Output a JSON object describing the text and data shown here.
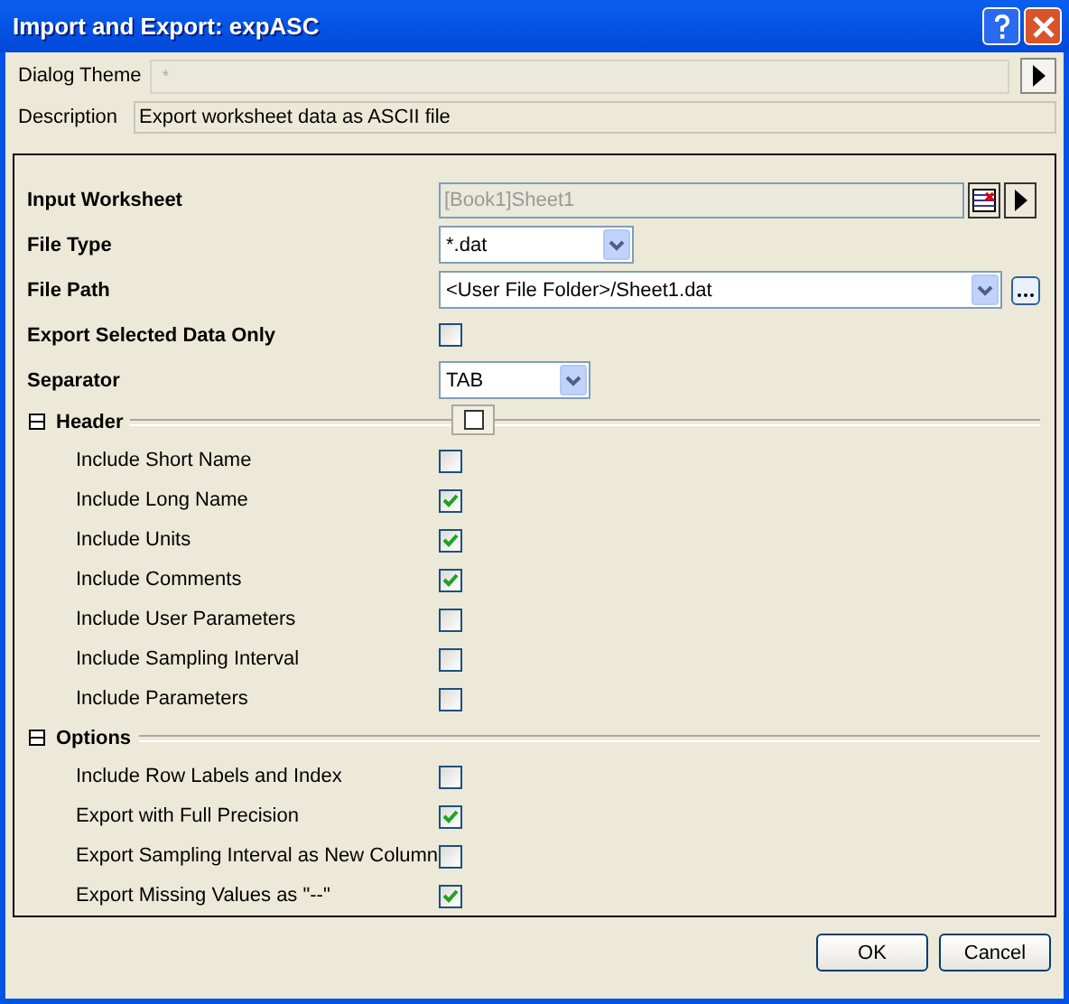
{
  "window": {
    "title": "Import and Export: expASC"
  },
  "theme": {
    "label": "Dialog Theme",
    "value": "*"
  },
  "description": {
    "label": "Description",
    "value": "Export worksheet data as ASCII file"
  },
  "fields": [
    {
      "kind": "picker",
      "label": "Input Worksheet",
      "value": "[Book1]Sheet1",
      "disabled": true
    },
    {
      "kind": "combo",
      "label": "File Type",
      "value": "*.dat"
    },
    {
      "kind": "path",
      "label": "File Path",
      "value": "<User File Folder>/Sheet1.dat"
    },
    {
      "kind": "check",
      "label": "Export Selected Data Only",
      "checked": false
    },
    {
      "kind": "combo-small",
      "label": "Separator",
      "value": "TAB"
    }
  ],
  "groups": [
    {
      "title": "Header",
      "expanded": true,
      "has_toggle": true,
      "items": [
        {
          "label": "Include Short Name",
          "checked": false
        },
        {
          "label": "Include Long Name",
          "checked": true
        },
        {
          "label": "Include Units",
          "checked": true
        },
        {
          "label": "Include Comments",
          "checked": true
        },
        {
          "label": "Include User Parameters",
          "checked": false
        },
        {
          "label": "Include Sampling Interval",
          "checked": false
        },
        {
          "label": "Include Parameters",
          "checked": false
        }
      ]
    },
    {
      "title": "Options",
      "expanded": true,
      "has_toggle": false,
      "items": [
        {
          "label": "Include Row Labels and Index",
          "checked": false
        },
        {
          "label": "Export with Full Precision",
          "checked": true
        },
        {
          "label": "Export Sampling Interval as New Column",
          "checked": false
        },
        {
          "label": "Export Missing Values as \"--\"",
          "checked": true
        }
      ]
    }
  ],
  "buttons": [
    "OK",
    "Cancel"
  ]
}
